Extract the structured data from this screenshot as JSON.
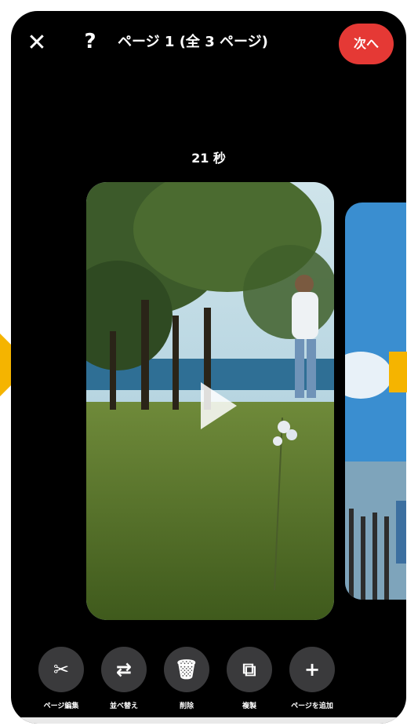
{
  "header": {
    "close_icon": "close-icon",
    "help_icon": "help-icon",
    "title": "ページ 1 (全 3 ページ)",
    "next_label": "次へ"
  },
  "clip": {
    "duration": "21 秒"
  },
  "toolbar": {
    "items": [
      {
        "icon": "scissors-icon",
        "glyph": "✂",
        "label": "ページ編集"
      },
      {
        "icon": "swap-icon",
        "glyph": "⇄",
        "label": "並べ替え"
      },
      {
        "icon": "trash-icon",
        "glyph": "🗑",
        "label": "削除"
      },
      {
        "icon": "duplicate-icon",
        "glyph": "⧉",
        "label": "複製"
      },
      {
        "icon": "plus-icon",
        "glyph": "+",
        "label": "ページを追加"
      }
    ]
  },
  "colors": {
    "accent": "#e53935",
    "annotation_arrow": "#f5b400",
    "background": "#000000"
  }
}
